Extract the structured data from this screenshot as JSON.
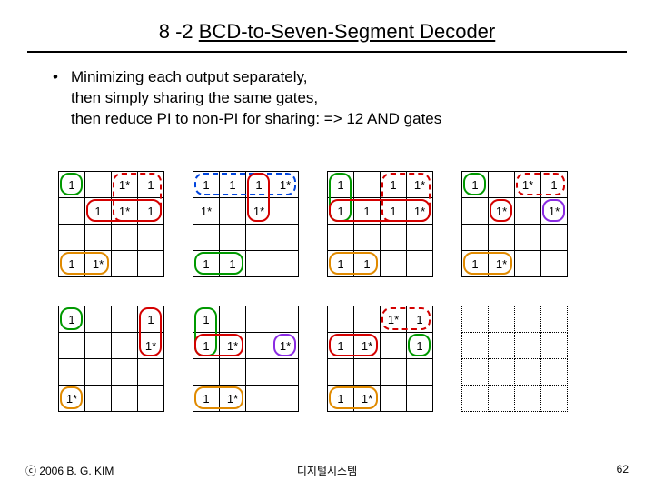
{
  "title": {
    "plain": "8 -2 ",
    "underlined": "BCD-to-Seven-Segment Decoder"
  },
  "bullets": {
    "l1": "Minimizing each output separately,",
    "l2": "then simply sharing the same gates,",
    "l3": "then reduce PI to non-PI for sharing: => 12 AND gates"
  },
  "footer": {
    "left": "ⓒ 2006  B. G. KIM",
    "center": "디지털시스템",
    "right": "62"
  },
  "sym": {
    "one": "1",
    "one_star": "1*"
  },
  "chart_data": {
    "type": "table",
    "description": "Eight 4×4 Karnaugh maps (plus one blank placeholder) for the seven-segment decoder outputs, annotated with 1 and 1* minterm/don't-care marks. Colored rounded outlines indicate prime-implicant groupings (shown approximately).",
    "kmaps": [
      {
        "id": "a",
        "pos": {
          "row": 0,
          "col": 0
        },
        "cells": [
          [
            "1",
            "",
            "1*",
            "1"
          ],
          [
            "",
            "1",
            "1*",
            "1"
          ],
          [
            "",
            "",
            "",
            ""
          ],
          [
            "1",
            "1*",
            "",
            ""
          ]
        ]
      },
      {
        "id": "b",
        "pos": {
          "row": 0,
          "col": 1
        },
        "cells": [
          [
            "1",
            "1",
            "1",
            "1*"
          ],
          [
            "1*",
            "",
            "1*",
            ""
          ],
          [
            "",
            "",
            "",
            ""
          ],
          [
            "1",
            "1",
            "",
            ""
          ]
        ]
      },
      {
        "id": "c",
        "pos": {
          "row": 0,
          "col": 2
        },
        "cells": [
          [
            "1",
            "",
            "1",
            "1*"
          ],
          [
            "1",
            "1",
            "1",
            "1*"
          ],
          [
            "",
            "",
            "",
            ""
          ],
          [
            "1",
            "1",
            "",
            ""
          ]
        ]
      },
      {
        "id": "d",
        "pos": {
          "row": 0,
          "col": 3
        },
        "cells": [
          [
            "1",
            "",
            "1*",
            "1"
          ],
          [
            "",
            "1*",
            "",
            "1*"
          ],
          [
            "",
            "",
            "",
            ""
          ],
          [
            "1",
            "1*",
            "",
            ""
          ]
        ]
      },
      {
        "id": "e",
        "pos": {
          "row": 1,
          "col": 0
        },
        "cells": [
          [
            "1",
            "",
            "",
            "1"
          ],
          [
            "",
            "",
            "",
            "1*"
          ],
          [
            "",
            "",
            "",
            ""
          ],
          [
            "1*",
            "",
            "",
            ""
          ]
        ]
      },
      {
        "id": "f",
        "pos": {
          "row": 1,
          "col": 1
        },
        "cells": [
          [
            "1",
            "",
            "",
            ""
          ],
          [
            "1",
            "1*",
            "",
            "1*"
          ],
          [
            "",
            "",
            "",
            ""
          ],
          [
            "1",
            "1*",
            "",
            ""
          ]
        ]
      },
      {
        "id": "g",
        "pos": {
          "row": 1,
          "col": 2
        },
        "cells": [
          [
            "",
            "",
            "1*",
            "1"
          ],
          [
            "1",
            "1*",
            "",
            "1"
          ],
          [
            "",
            "",
            "",
            ""
          ],
          [
            "1",
            "1*",
            "",
            ""
          ]
        ]
      },
      {
        "id": "placeholder",
        "pos": {
          "row": 1,
          "col": 3
        },
        "cells": [
          [
            "",
            "",
            "",
            ""
          ],
          [
            "",
            "",
            "",
            ""
          ],
          [
            "",
            "",
            "",
            ""
          ],
          [
            "",
            "",
            "",
            ""
          ]
        ],
        "ghost": true
      }
    ],
    "group_overlays_note": "Group outlines are drawn approximately with colored rounded rectangles; exact PI groupings are not fully recoverable from the raster."
  }
}
